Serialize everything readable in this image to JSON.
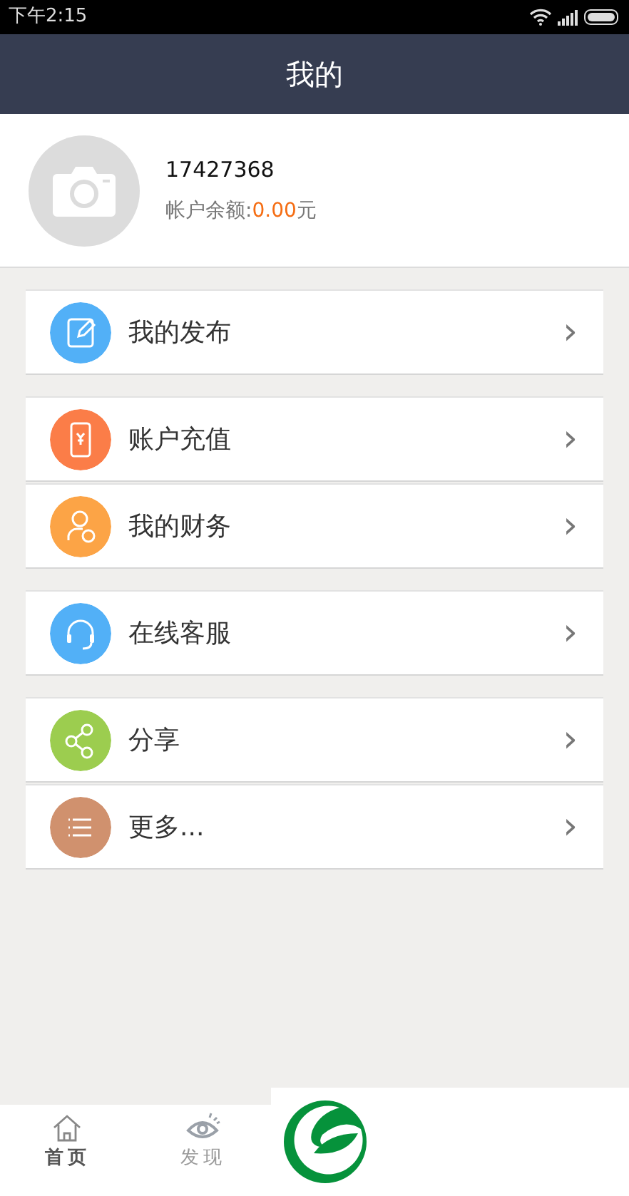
{
  "status_bar": {
    "time": "下午2:15"
  },
  "header": {
    "title": "我的"
  },
  "profile": {
    "user_id": "17427368",
    "balance_label": "帐户余额:",
    "balance_value": "0.00",
    "balance_unit": "元"
  },
  "menu_groups": [
    {
      "items": [
        {
          "label": "我的发布",
          "kind": "edit",
          "color": "#52b0f7",
          "arrow": "›"
        }
      ]
    },
    {
      "items": [
        {
          "label": "账户充值",
          "kind": "recharge",
          "color": "#fb7d48",
          "arrow": "›"
        },
        {
          "label": "我的财务",
          "kind": "finance",
          "color": "#fca446",
          "arrow": "›"
        }
      ]
    },
    {
      "items": [
        {
          "label": "在线客服",
          "kind": "headset",
          "color": "#52b0f7",
          "arrow": "›"
        }
      ]
    },
    {
      "items": [
        {
          "label": "分享",
          "kind": "share",
          "color": "#9ccd4f",
          "arrow": "›"
        },
        {
          "label": "更多...",
          "kind": "list",
          "color": "#d0916e",
          "arrow": "›"
        }
      ]
    }
  ],
  "tab_bar": [
    {
      "label": "首页",
      "kind": "home",
      "selected": true
    },
    {
      "label": "发现",
      "kind": "discover",
      "selected": false
    }
  ]
}
